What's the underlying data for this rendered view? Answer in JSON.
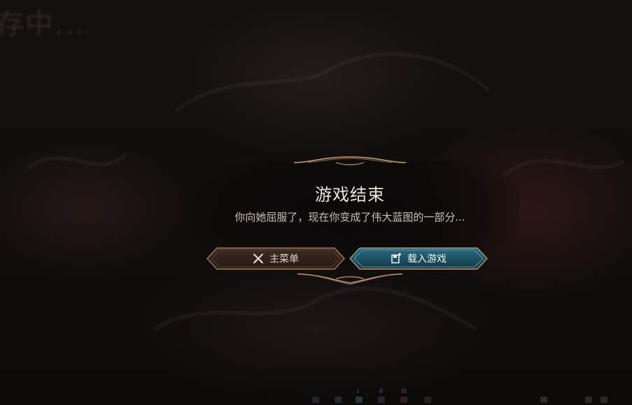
{
  "background": {
    "saving_text": "存中..."
  },
  "dialog": {
    "title": "游戏结束",
    "message": "你向她屈服了，现在你变成了伟大蓝图的一部分...",
    "buttons": {
      "main_menu": {
        "label": "主菜单",
        "icon": "crossed-swords-icon"
      },
      "load_game": {
        "label": "载入游戏",
        "icon": "load-save-icon"
      }
    }
  },
  "hotbar": {
    "pages": [
      "I",
      "II",
      "III"
    ]
  },
  "colors": {
    "ornament_gold": "#b08a63",
    "load_button_teal": "#1f5a6e",
    "main_button_brown": "#3a2a22",
    "title_text": "#ece4d6"
  }
}
